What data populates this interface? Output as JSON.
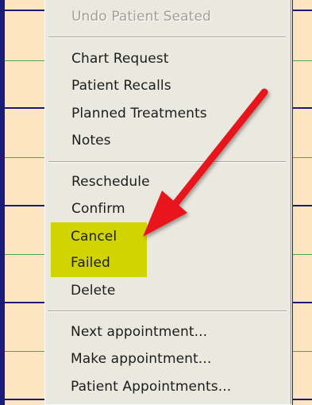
{
  "context_menu": {
    "items": [
      {
        "label": "Undo Patient Seated",
        "enabled": false
      },
      {
        "label": "Chart Request",
        "enabled": true
      },
      {
        "label": "Patient Recalls",
        "enabled": true
      },
      {
        "label": "Planned Treatments",
        "enabled": true
      },
      {
        "label": "Notes",
        "enabled": true
      },
      {
        "label": "Reschedule",
        "enabled": true
      },
      {
        "label": "Confirm",
        "enabled": true
      },
      {
        "label": "Cancel",
        "enabled": true,
        "highlighted": true
      },
      {
        "label": "Failed",
        "enabled": true,
        "highlighted": true
      },
      {
        "label": "Delete",
        "enabled": true
      },
      {
        "label": "Next appointment...",
        "enabled": true
      },
      {
        "label": "Make appointment...",
        "enabled": true
      },
      {
        "label": "Patient Appointments...",
        "enabled": true
      }
    ]
  },
  "annotation": {
    "highlight_color": "#d2d400",
    "arrow_color": "#e8141c",
    "arrow_icon": "red-arrow-icon"
  },
  "colors": {
    "schedule_background": "#fce6c2",
    "schedule_major_line": "#1a1a7a",
    "schedule_minor_line": "#4aa84a",
    "menu_background": "#eae9e0"
  }
}
